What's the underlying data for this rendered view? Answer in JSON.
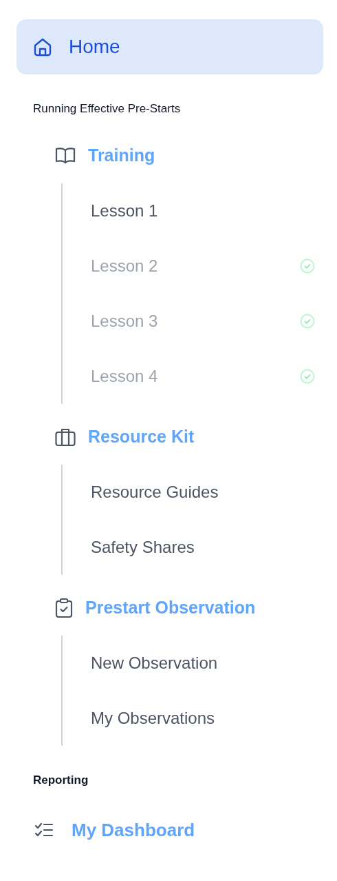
{
  "home": {
    "label": "Home",
    "selected": true
  },
  "sections": [
    {
      "title": "Running Effective Pre-Starts",
      "kind": "groups",
      "groups": [
        {
          "label": "Training",
          "items": [
            {
              "label": "Lesson 1",
              "completed": false
            },
            {
              "label": "Lesson 2",
              "completed": true
            },
            {
              "label": "Lesson 3",
              "completed": true
            },
            {
              "label": "Lesson 4",
              "completed": true
            }
          ]
        },
        {
          "label": "Resource Kit",
          "items": [
            {
              "label": "Resource Guides",
              "completed": false
            },
            {
              "label": "Safety Shares",
              "completed": false
            }
          ]
        },
        {
          "label": "Prestart Observation",
          "items": [
            {
              "label": "New Observation",
              "completed": false
            },
            {
              "label": "My Observations",
              "completed": false
            }
          ]
        }
      ]
    },
    {
      "title": "Reporting",
      "kind": "links",
      "links": [
        {
          "label": "My Dashboard"
        }
      ]
    }
  ]
}
